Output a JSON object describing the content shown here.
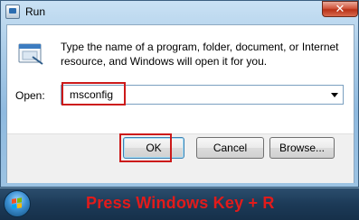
{
  "window": {
    "title": "Run",
    "close_label": "✕",
    "description": "Type the name of a program, folder, document, or Internet resource, and Windows will open it for you.",
    "open_label": "Open:",
    "open_value": "msconfig",
    "ok_label": "OK",
    "cancel_label": "Cancel",
    "browse_label": "Browse..."
  },
  "taskbar": {
    "caption": "Press Windows Key + R"
  },
  "icons": {
    "window_icon": "run-icon",
    "app_icon": "run-app-icon",
    "start": "windows-start-orb-icon",
    "dropdown": "chevron-down-icon"
  },
  "colors": {
    "highlight": "#cc1a1a",
    "caption": "#e21b1b",
    "close": "#c7432a"
  }
}
